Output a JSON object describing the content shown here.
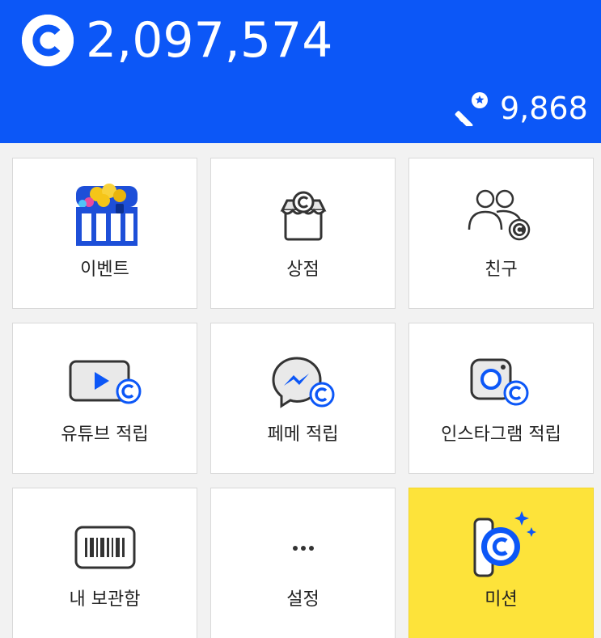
{
  "header": {
    "balance": "2,097,574",
    "key_count": "9,868",
    "coin_icon": "coin-logo-icon",
    "key_icon": "key-icon"
  },
  "menu": {
    "items": [
      {
        "label": "이벤트",
        "icon": "treasure-chest-icon"
      },
      {
        "label": "상점",
        "icon": "store-icon"
      },
      {
        "label": "친구",
        "icon": "friends-icon"
      },
      {
        "label": "유튜브 적립",
        "icon": "youtube-icon"
      },
      {
        "label": "페메 적립",
        "icon": "messenger-icon"
      },
      {
        "label": "인스타그램 적립",
        "icon": "instagram-icon"
      },
      {
        "label": "내 보관함",
        "icon": "barcode-icon"
      },
      {
        "label": "설정",
        "icon": "more-dots-icon"
      },
      {
        "label": "미션",
        "icon": "mission-phone-icon"
      }
    ]
  },
  "colors": {
    "brand_blue": "#0c57f7",
    "mission_yellow": "#fde33a",
    "background": "#f2f2f2"
  }
}
